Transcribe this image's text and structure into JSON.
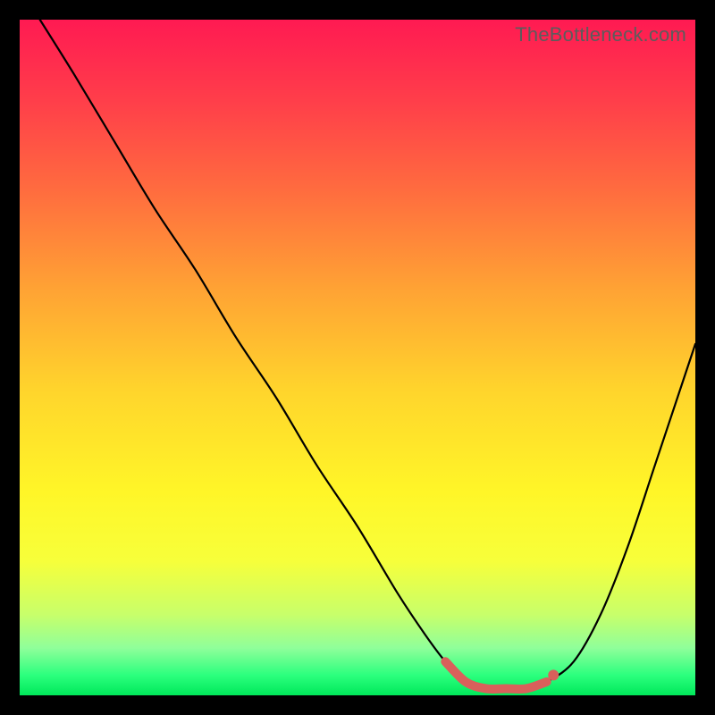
{
  "watermark": "TheBottleneck.com",
  "colors": {
    "curve": "#000000",
    "accent": "#d9605b"
  },
  "chart_data": {
    "type": "line",
    "title": "",
    "xlabel": "",
    "ylabel": "",
    "xlim": [
      0,
      100
    ],
    "ylim": [
      0,
      100
    ],
    "series": [
      {
        "name": "bottleneck",
        "x": [
          3,
          8,
          14,
          20,
          26,
          32,
          38,
          44,
          50,
          56,
          60,
          63,
          66,
          69,
          72,
          75,
          78,
          82,
          86,
          90,
          94,
          98,
          100
        ],
        "y": [
          100,
          92,
          82,
          72,
          63,
          53,
          44,
          34,
          25,
          15,
          9,
          5,
          2,
          1,
          1,
          1,
          2,
          5,
          12,
          22,
          34,
          46,
          52
        ]
      }
    ],
    "optimal_range": {
      "x": [
        63,
        66,
        69,
        72,
        75,
        78
      ],
      "y": [
        5,
        2,
        1,
        1,
        1,
        2
      ],
      "end_dot": {
        "x": 79,
        "y": 3
      }
    }
  }
}
